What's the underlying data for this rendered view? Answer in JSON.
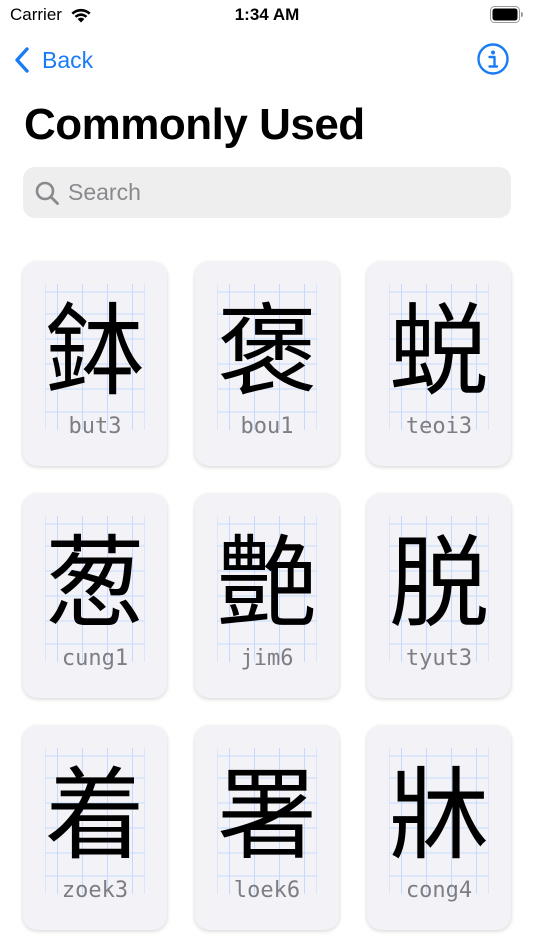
{
  "status_bar": {
    "carrier": "Carrier",
    "time": "1:34 AM"
  },
  "nav": {
    "back_label": "Back",
    "info_icon": "info-circle-icon"
  },
  "title": "Commonly Used",
  "search": {
    "placeholder": "Search",
    "value": ""
  },
  "colors": {
    "accent": "#1a7cf5",
    "card_bg": "#f2f2f7",
    "guide_lines": "#b9d4ff",
    "romanization": "#7d7d82"
  },
  "cards": [
    {
      "character": "鉢",
      "romanization": "but3"
    },
    {
      "character": "褒",
      "romanization": "bou1"
    },
    {
      "character": "蜕",
      "romanization": "teoi3"
    },
    {
      "character": "葱",
      "romanization": "cung1"
    },
    {
      "character": "艶",
      "romanization": "jim6"
    },
    {
      "character": "脱",
      "romanization": "tyut3"
    },
    {
      "character": "着",
      "romanization": "zoek3"
    },
    {
      "character": "署",
      "romanization": "loek6"
    },
    {
      "character": "牀",
      "romanization": "cong4"
    }
  ]
}
